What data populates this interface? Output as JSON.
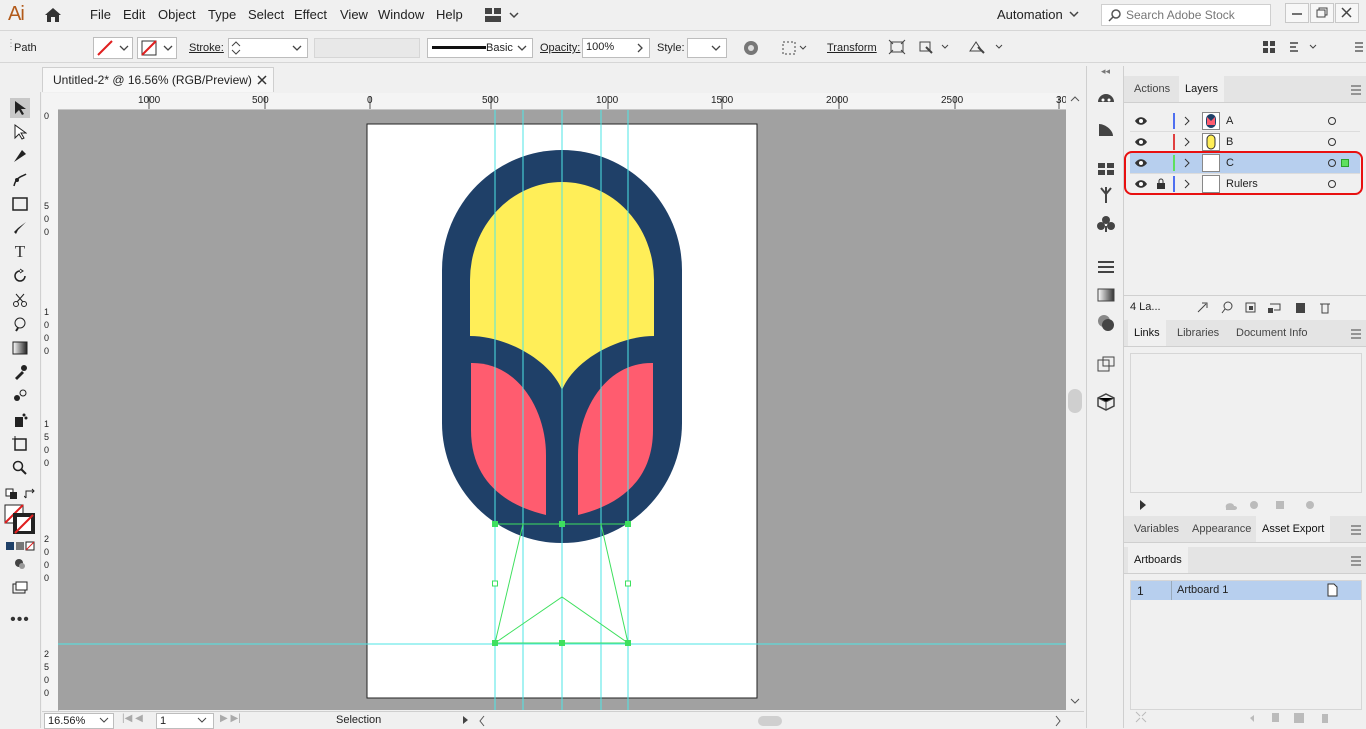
{
  "app": {
    "logo": "Ai"
  },
  "menu": [
    "File",
    "Edit",
    "Object",
    "Type",
    "Select",
    "Effect",
    "View",
    "Window",
    "Help"
  ],
  "workspace": {
    "label": "Automation"
  },
  "search": {
    "placeholder": "Search Adobe Stock"
  },
  "control": {
    "selection_label": "Path",
    "stroke_label": "Stroke:",
    "brush_label": "Basic",
    "opacity_label": "Opacity:",
    "opacity_value": "100%",
    "style_label": "Style:",
    "transform_label": "Transform"
  },
  "document": {
    "tab_title": "Untitled-2* @ 16.56% (RGB/Preview)"
  },
  "ruler": {
    "top_ticks": [
      "1000",
      "500",
      "0",
      "500",
      "1000",
      "1500",
      "2000",
      "2500",
      "30"
    ],
    "left_ticks": [
      "0",
      "5",
      "0",
      "0",
      "1",
      "0",
      "0",
      "0",
      "1",
      "5",
      "0",
      "0",
      "2",
      "0",
      "0",
      "0",
      "2",
      "5",
      "0",
      "0"
    ]
  },
  "status": {
    "zoom": "16.56%",
    "artboard_num": "1",
    "tool": "Selection"
  },
  "layers_panel": {
    "tabs": [
      "Actions",
      "Layers"
    ],
    "active_tab": "Layers",
    "layers": [
      {
        "name": "A",
        "color": "#4f6ff0",
        "locked": false
      },
      {
        "name": "B",
        "color": "#e04040",
        "locked": false
      },
      {
        "name": "C",
        "color": "#5ee05e",
        "locked": false,
        "selected": true
      },
      {
        "name": "Rulers",
        "color": "#4f6ff0",
        "locked": true
      }
    ],
    "count_label": "4 La..."
  },
  "links_panel": {
    "tabs": [
      "Links",
      "Libraries",
      "Document Info"
    ]
  },
  "asset_panel": {
    "tabs": [
      "Variables",
      "Appearance",
      "Asset Export"
    ],
    "active_tab": "Asset Export"
  },
  "artboards_panel": {
    "title": "Artboards",
    "items": [
      {
        "num": "1",
        "name": "Artboard 1"
      }
    ]
  },
  "colors": {
    "navy": "#1f4068",
    "yellow": "#ffee58",
    "pink": "#ff5c6f",
    "guide": "#4de6e6",
    "canvas": "#a1a1a1",
    "highlight": "#e81010"
  }
}
